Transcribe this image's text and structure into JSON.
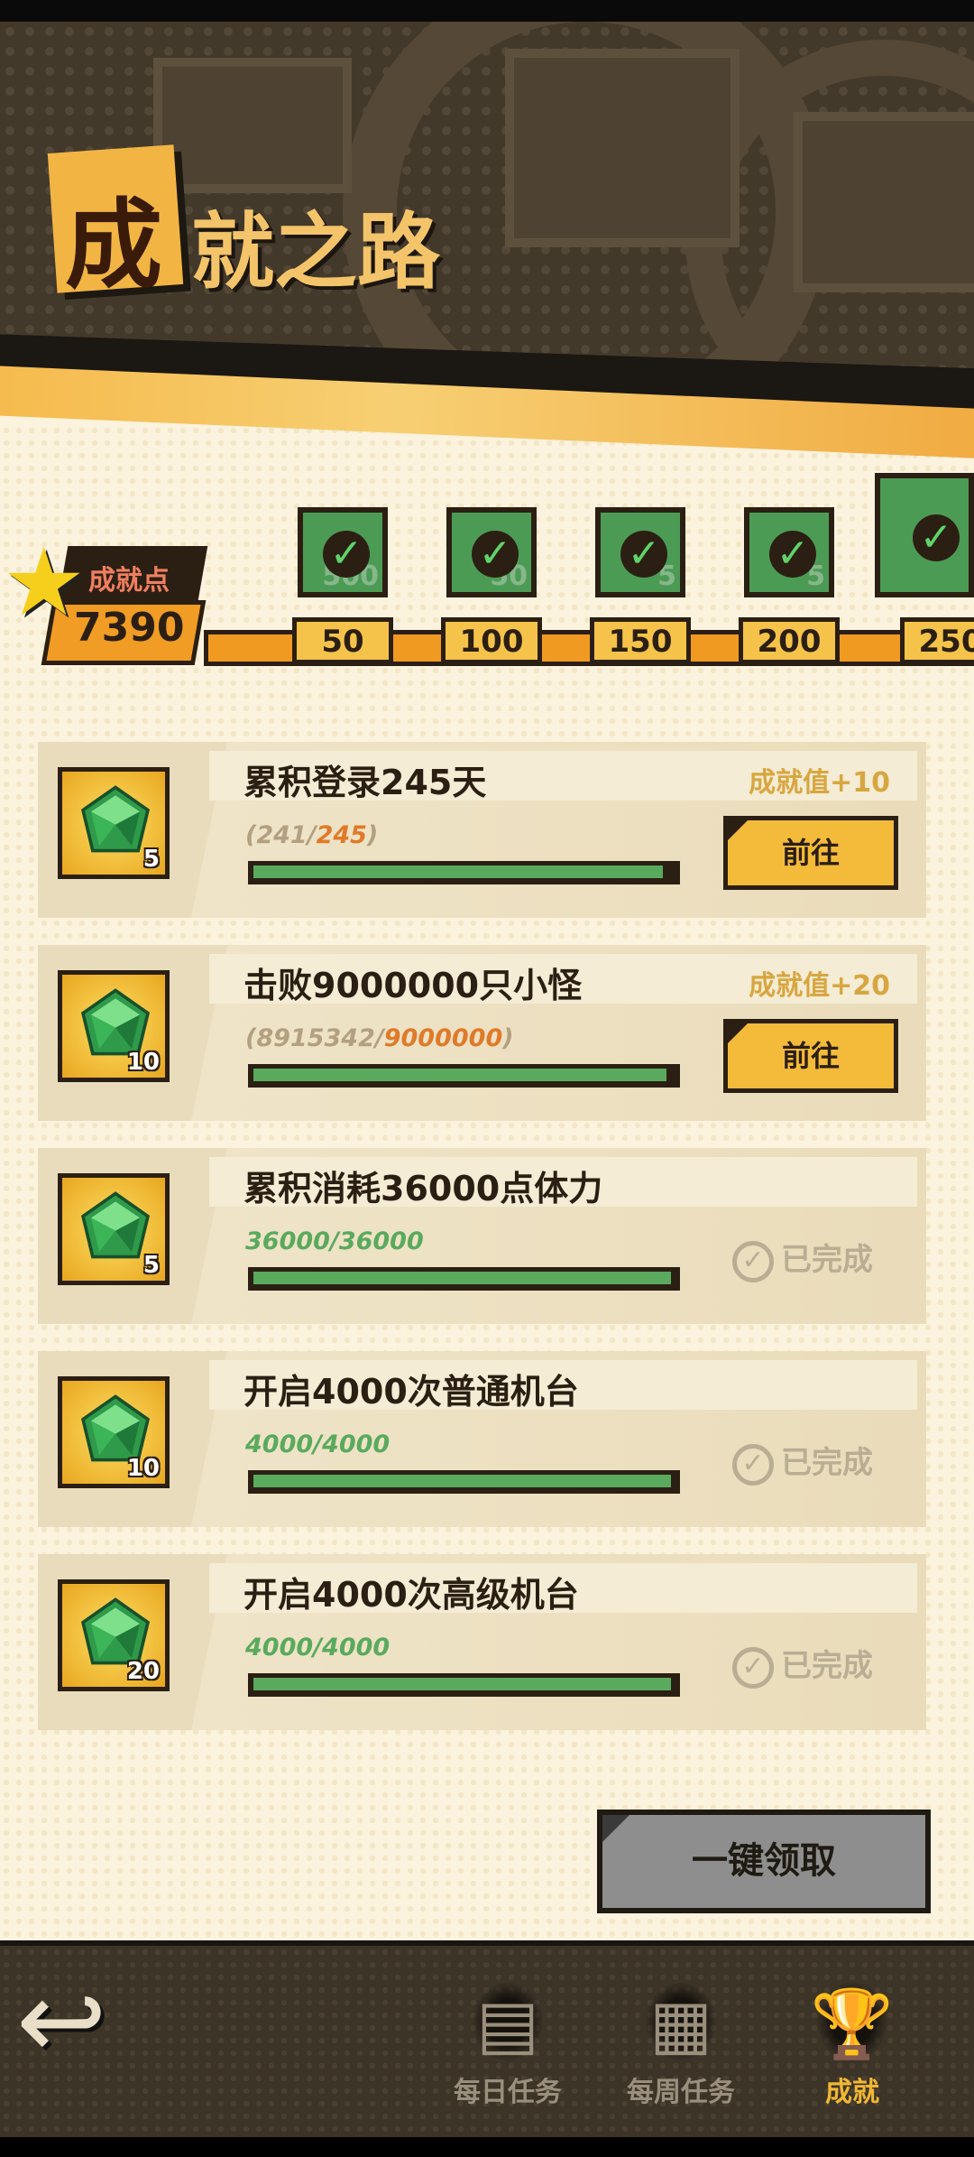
{
  "title": {
    "first_char": "成",
    "rest": "就之路"
  },
  "points": {
    "label": "成就点",
    "value": "7390"
  },
  "milestones": [
    {
      "threshold": "50",
      "reward_count": "500",
      "claimed": true
    },
    {
      "threshold": "100",
      "reward_count": "50",
      "claimed": true
    },
    {
      "threshold": "150",
      "reward_count": "5",
      "claimed": true
    },
    {
      "threshold": "200",
      "reward_count": "5",
      "claimed": true
    },
    {
      "threshold": "250",
      "reward_count": "",
      "claimed": true
    }
  ],
  "tasks": [
    {
      "title": "累积登录245天",
      "reward_points": "成就值+10",
      "gem_count": "5",
      "progress_current": "241",
      "progress_total": "245",
      "progress_open": "(",
      "progress_close": ")",
      "progress_fraction": 0.98,
      "status": "go",
      "action_label": "前往"
    },
    {
      "title": "击败9000000只小怪",
      "reward_points": "成就值+20",
      "gem_count": "10",
      "progress_current": "8915342",
      "progress_total": "9000000",
      "progress_open": "(",
      "progress_close": ")",
      "progress_fraction": 0.99,
      "status": "go",
      "action_label": "前往"
    },
    {
      "title": "累积消耗36000点体力",
      "reward_points": "",
      "gem_count": "5",
      "progress_current": "36000",
      "progress_total": "36000",
      "progress_open": "",
      "progress_close": "",
      "progress_fraction": 1.0,
      "status": "done",
      "action_label": "已完成"
    },
    {
      "title": "开启4000次普通机台",
      "reward_points": "",
      "gem_count": "10",
      "progress_current": "4000",
      "progress_total": "4000",
      "progress_open": "",
      "progress_close": "",
      "progress_fraction": 1.0,
      "status": "done",
      "action_label": "已完成"
    },
    {
      "title": "开启4000次高级机台",
      "reward_points": "",
      "gem_count": "20",
      "progress_current": "4000",
      "progress_total": "4000",
      "progress_open": "",
      "progress_close": "",
      "progress_fraction": 1.0,
      "status": "done",
      "action_label": "已完成"
    }
  ],
  "claim_all_label": "一键领取",
  "nav": {
    "tabs": [
      {
        "label": "每日任务",
        "icon": "daily-tasks-icon",
        "active": false
      },
      {
        "label": "每周任务",
        "icon": "weekly-tasks-icon",
        "active": false
      },
      {
        "label": "成就",
        "icon": "trophy-icon",
        "active": true
      }
    ]
  },
  "colors": {
    "gold": "#f4bb3b",
    "progress_green": "#5aaa5e",
    "orange": "#f19a22",
    "dark": "#2b1f13",
    "done_gray": "#b9ad94"
  }
}
